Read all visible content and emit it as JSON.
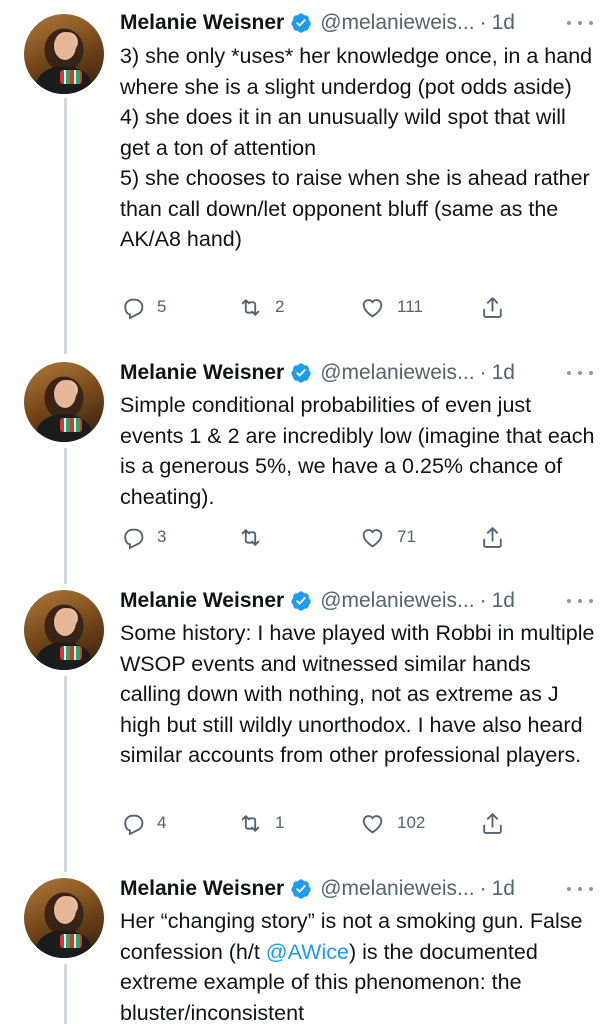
{
  "tweets": [
    {
      "name": "Melanie Weisner",
      "handle": "@melanieweis...",
      "separator": "·",
      "time": "1d",
      "text": "3) she only *uses* her knowledge once, in a hand where she is a slight underdog (pot odds aside)\n4) she does it in an unusually wild spot that will get a ton of attention\n5) she chooses to raise when she is ahead rather than call down/let opponent bluff (same as the AK/A8 hand)",
      "replies": "5",
      "retweets": "2",
      "likes": "111"
    },
    {
      "name": "Melanie Weisner",
      "handle": "@melanieweis...",
      "separator": "·",
      "time": "1d",
      "text": "Simple conditional probabilities of even just events 1 & 2 are incredibly low (imagine that each is a generous 5%, we have a 0.25% chance of cheating).",
      "replies": "3",
      "retweets": "",
      "likes": "71"
    },
    {
      "name": "Melanie Weisner",
      "handle": "@melanieweis...",
      "separator": "·",
      "time": "1d",
      "text": "Some history: I have played with Robbi in multiple WSOP events and witnessed similar hands calling down with nothing, not as extreme as J high but still wildly unorthodox. I have also heard similar accounts from other professional players.",
      "replies": "4",
      "retweets": "1",
      "likes": "102"
    },
    {
      "name": "Melanie Weisner",
      "handle": "@melanieweis...",
      "separator": "·",
      "time": "1d",
      "text_before": "Her “changing story” is not a smoking gun. False confession (h/t ",
      "mention": "@AWice",
      "text_after": ") is the documented extreme example of this phenomenon: the bluster/inconsistent"
    }
  ],
  "colors": {
    "verified_badge": "#1d9bf0",
    "mention": "#1d9bf0",
    "meta_text": "#536471",
    "thread_line": "#cfd9de"
  },
  "icons": {
    "verified": "verified-badge-icon",
    "more": "more-options-icon",
    "reply": "reply-icon",
    "retweet": "retweet-icon",
    "like": "heart-icon",
    "share": "share-icon"
  }
}
